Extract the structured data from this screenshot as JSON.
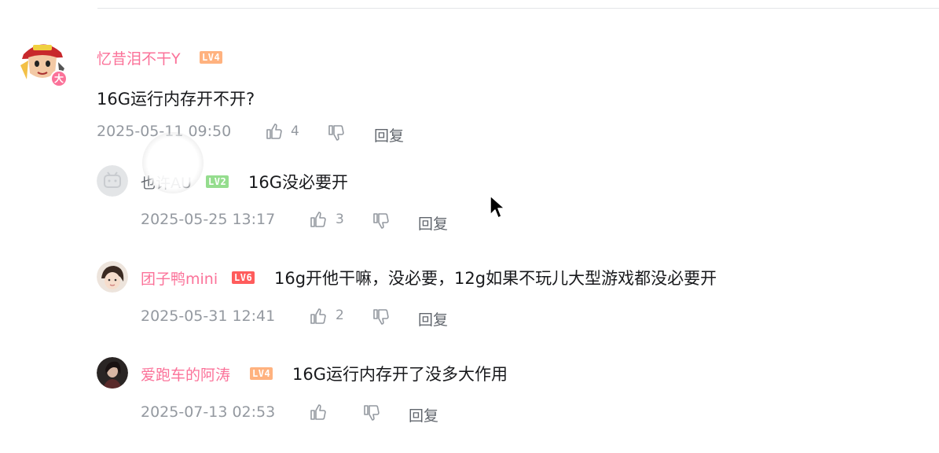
{
  "comment": {
    "username": "忆昔泪不干Y",
    "level": "LV4",
    "vip_badge": "大",
    "content": "16G运行内存开不开?",
    "time": "2025-05-11 09:50",
    "likes": "4",
    "reply_label": "回复"
  },
  "replies": [
    {
      "username": "也许AU",
      "level": "LV2",
      "content": "16G没必要开",
      "time": "2025-05-25 13:17",
      "likes": "3",
      "reply_label": "回复"
    },
    {
      "username": "团子鸭mini",
      "level": "LV6",
      "content": "16g开他干嘛，没必要，12g如果不玩儿大型游戏都没必要开",
      "time": "2025-05-31 12:41",
      "likes": "2",
      "reply_label": "回复"
    },
    {
      "username": "爱跑车的阿涛",
      "level": "LV4",
      "content": "16G运行内存开了没多大作用",
      "time": "2025-07-13 02:53",
      "likes": "",
      "reply_label": "回复"
    }
  ],
  "colors": {
    "username_pink": "#fb7299",
    "meta_gray": "#9499a0",
    "level4": "#ffb27f",
    "level2": "#95dd8e",
    "level6": "#ff5c5c"
  },
  "icons": [
    "thumbs-up-icon",
    "thumbs-down-icon",
    "mouse-pointer-icon"
  ]
}
